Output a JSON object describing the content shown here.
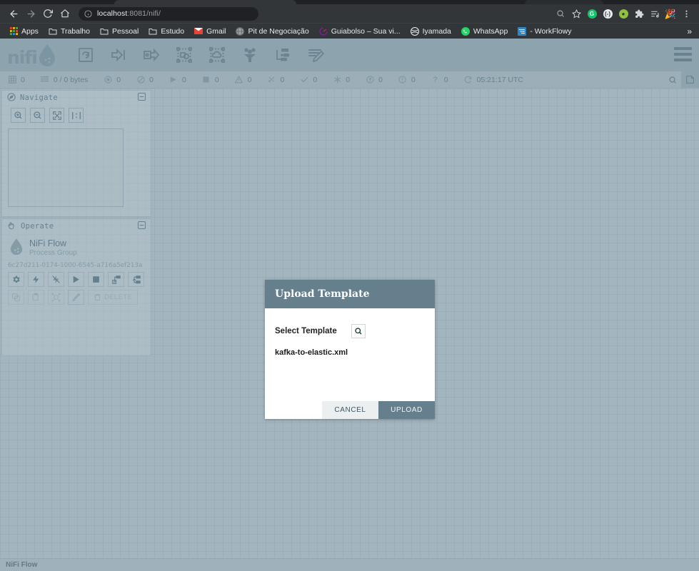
{
  "browser": {
    "nav": {
      "back": "back-arrow",
      "forward": "forward-arrow",
      "reload": "reload",
      "home": "home"
    },
    "omnibox": {
      "info_icon": "info-circle",
      "host": "localhost",
      "path": ":8081/nifi/",
      "full_url": "localhost:8081/nifi/"
    },
    "right_icons": [
      "search-icon",
      "star-icon",
      "grammarly-extension",
      "profile-extension",
      "key-extension",
      "puzzle-extension",
      "media-list-icon",
      "avatar",
      "more-menu"
    ],
    "bookmarks": [
      {
        "label": "Apps",
        "icon": "apps-grid-icon"
      },
      {
        "label": "Trabalho",
        "icon": "folder-icon"
      },
      {
        "label": "Pessoal",
        "icon": "folder-icon"
      },
      {
        "label": "Estudo",
        "icon": "folder-icon"
      },
      {
        "label": "Gmail",
        "icon": "gmail-icon"
      },
      {
        "label": "Pit de Negociação",
        "icon": "globe-icon"
      },
      {
        "label": "Guiabolso – Sua vi...",
        "icon": "guiabolso-icon"
      },
      {
        "label": "Iyamada",
        "icon": "globe-icon"
      },
      {
        "label": "WhatsApp",
        "icon": "whatsapp-icon"
      },
      {
        "label": "- WorkFlowy",
        "icon": "workflowy-icon"
      }
    ],
    "bookmarks_overflow": "»"
  },
  "nifi": {
    "logo_text": "nifi",
    "toolbar_icons": [
      "processor-icon",
      "input-port-icon",
      "output-port-icon",
      "process-group-icon",
      "remote-process-group-icon",
      "funnel-icon",
      "template-icon",
      "label-icon"
    ],
    "menu_icon": "hamburger-menu-icon",
    "status": [
      {
        "icon": "process-group-icon",
        "value": "0"
      },
      {
        "icon": "queue-icon",
        "value": "0 / 0 bytes"
      },
      {
        "icon": "transmitting-icon",
        "value": "0"
      },
      {
        "icon": "not-transmitting-icon",
        "value": "0"
      },
      {
        "icon": "running-icon",
        "value": "0"
      },
      {
        "icon": "stopped-icon",
        "value": "0"
      },
      {
        "icon": "invalid-icon",
        "value": "0"
      },
      {
        "icon": "disabled-icon",
        "value": "0"
      },
      {
        "icon": "up-to-date-icon",
        "value": "0"
      },
      {
        "icon": "locally-modified-icon",
        "value": "0"
      },
      {
        "icon": "stale-icon",
        "value": "0"
      },
      {
        "icon": "locally-modified-and-stale-icon",
        "value": "0"
      },
      {
        "icon": "sync-failure-icon",
        "value": "0"
      }
    ],
    "refresh": {
      "icon": "refresh-icon",
      "time": "05:21:17 UTC"
    },
    "status_buttons": [
      "search-icon",
      "bulletin-board-icon"
    ],
    "navigate": {
      "title": "Navigate",
      "icon": "compass-icon",
      "collapse_icon": "collapse-icon",
      "tools": [
        "zoom-in-icon",
        "zoom-out-icon",
        "fit-to-screen-icon",
        "actual-size-icon"
      ]
    },
    "operate": {
      "title": "Operate",
      "icon": "hand-icon",
      "collapse_icon": "collapse-icon",
      "component_name": "NiFi Flow",
      "component_type": "Process Group",
      "component_id": "6c27d211-0174-1000-6545-a716a5ef213a",
      "actions_row1": [
        "configure-icon",
        "enable-icon",
        "disable-icon",
        "start-icon",
        "stop-icon",
        "variable-registry-icon",
        "upload-template-icon"
      ],
      "actions_row2": [
        "copy-icon",
        "paste-icon",
        "group-icon",
        "color-icon"
      ],
      "delete_label": "DELETE",
      "delete_icon": "trash-icon"
    },
    "footer": {
      "breadcrumb": "NiFi Flow"
    }
  },
  "dialog": {
    "title": "Upload Template",
    "select_label": "Select Template",
    "browse_icon": "search-icon",
    "selected_file": "kafka-to-elastic.xml",
    "cancel_label": "CANCEL",
    "upload_label": "UPLOAD"
  },
  "colors": {
    "chrome_bg": "#323639",
    "nifi_header": "#8aa1ad",
    "nifi_canvas": "#a9bac3",
    "dialog_header": "#667f8c",
    "upload_button": "#667f8c",
    "cancel_button": "#eceff0"
  }
}
